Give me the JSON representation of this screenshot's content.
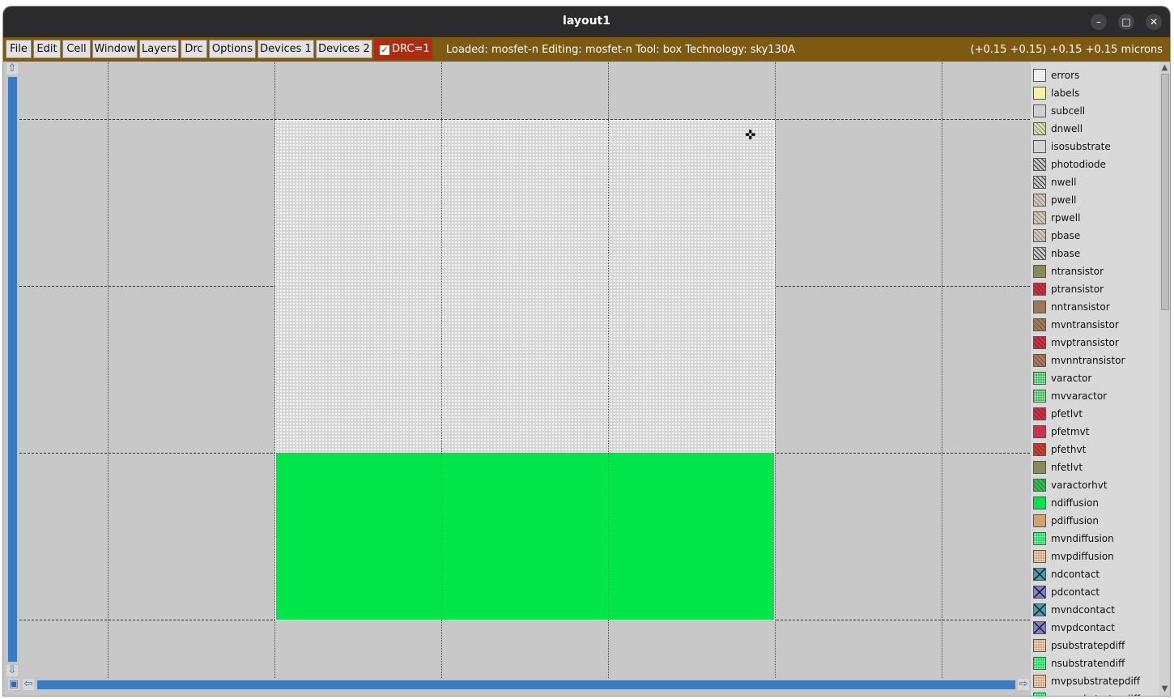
{
  "window": {
    "title": "layout1"
  },
  "window_controls": {
    "minimize": "–",
    "maximize": "□",
    "close": "✕"
  },
  "menu": {
    "items": [
      "File",
      "Edit",
      "Cell",
      "Window",
      "Layers",
      "Drc",
      "Options",
      "Devices 1",
      "Devices 2"
    ]
  },
  "drc": {
    "label": "DRC=1",
    "checked": true
  },
  "status": {
    "text": "Loaded: mosfet-n Editing: mosfet-n Tool: box  Technology: sky130A",
    "coords": "(+0.15 +0.15) +0.15 +0.15 microns"
  },
  "colors": {
    "menubar": "#7e5a10",
    "drc_badge": "#b02c10",
    "diffusion_fill": "#00e64a",
    "canvas": "#c8c8c8",
    "scrollbar": "#3a7cc3"
  },
  "scroll": {
    "up": "⇧",
    "down": "⇩",
    "left": "⇦",
    "right": "⇨"
  },
  "layers": [
    {
      "name": "errors",
      "color": "#e8e8e8",
      "pattern": "dots"
    },
    {
      "name": "labels",
      "color": "#f4f4a0",
      "pattern": "solid"
    },
    {
      "name": "subcell",
      "color": "#d0d0d0",
      "pattern": "solid"
    },
    {
      "name": "dnwell",
      "color": "#dcdcb0",
      "pattern": "hatch"
    },
    {
      "name": "isosubstrate",
      "color": "#d4d4d4",
      "pattern": "solid"
    },
    {
      "name": "photodiode",
      "color": "#c8c8c8",
      "pattern": "hatch-dark"
    },
    {
      "name": "nwell",
      "color": "#c8c8c8",
      "pattern": "hatch-dark"
    },
    {
      "name": "pwell",
      "color": "#d4c8bc",
      "pattern": "hatch"
    },
    {
      "name": "rpwell",
      "color": "#d4c8bc",
      "pattern": "hatch"
    },
    {
      "name": "pbase",
      "color": "#d4c8bc",
      "pattern": "hatch"
    },
    {
      "name": "nbase",
      "color": "#c8c8c8",
      "pattern": "hatch-dark"
    },
    {
      "name": "ntransistor",
      "color": "#8a8a55",
      "pattern": "solid"
    },
    {
      "name": "ptransistor",
      "color": "#d03040",
      "pattern": "hatch"
    },
    {
      "name": "nntransistor",
      "color": "#a07850",
      "pattern": "solid"
    },
    {
      "name": "mvntransistor",
      "color": "#a08050",
      "pattern": "hatch"
    },
    {
      "name": "mvptransistor",
      "color": "#d03040",
      "pattern": "hatch"
    },
    {
      "name": "mvnntransistor",
      "color": "#b07860",
      "pattern": "hatch"
    },
    {
      "name": "varactor",
      "color": "#30c050",
      "pattern": "dots"
    },
    {
      "name": "mvvaractor",
      "color": "#30c050",
      "pattern": "dots"
    },
    {
      "name": "pfetlvt",
      "color": "#d03040",
      "pattern": "hatch"
    },
    {
      "name": "pfetmvt",
      "color": "#d03050",
      "pattern": "solid"
    },
    {
      "name": "pfethvt",
      "color": "#d04030",
      "pattern": "hatch"
    },
    {
      "name": "nfetlvt",
      "color": "#8a8a55",
      "pattern": "solid"
    },
    {
      "name": "varactorhvt",
      "color": "#30c050",
      "pattern": "hatch"
    },
    {
      "name": "ndiffusion",
      "color": "#00e64a",
      "pattern": "solid"
    },
    {
      "name": "pdiffusion",
      "color": "#d8a070",
      "pattern": "solid"
    },
    {
      "name": "mvndiffusion",
      "color": "#00e64a",
      "pattern": "dots"
    },
    {
      "name": "mvpdiffusion",
      "color": "#d8a070",
      "pattern": "dots"
    },
    {
      "name": "ndcontact",
      "color": "#40a0b0",
      "pattern": "cross"
    },
    {
      "name": "pdcontact",
      "color": "#8080d0",
      "pattern": "cross"
    },
    {
      "name": "mvndcontact",
      "color": "#40a0b0",
      "pattern": "cross"
    },
    {
      "name": "mvpdcontact",
      "color": "#8080d0",
      "pattern": "cross"
    },
    {
      "name": "psubstratepdiff",
      "color": "#d8a070",
      "pattern": "dots"
    },
    {
      "name": "nsubstratendiff",
      "color": "#00e64a",
      "pattern": "dots"
    },
    {
      "name": "mvpsubstratepdiff",
      "color": "#d8a070",
      "pattern": "dots"
    },
    {
      "name": "mvnsubstratendiff",
      "color": "#00e64a",
      "pattern": "dots"
    }
  ]
}
